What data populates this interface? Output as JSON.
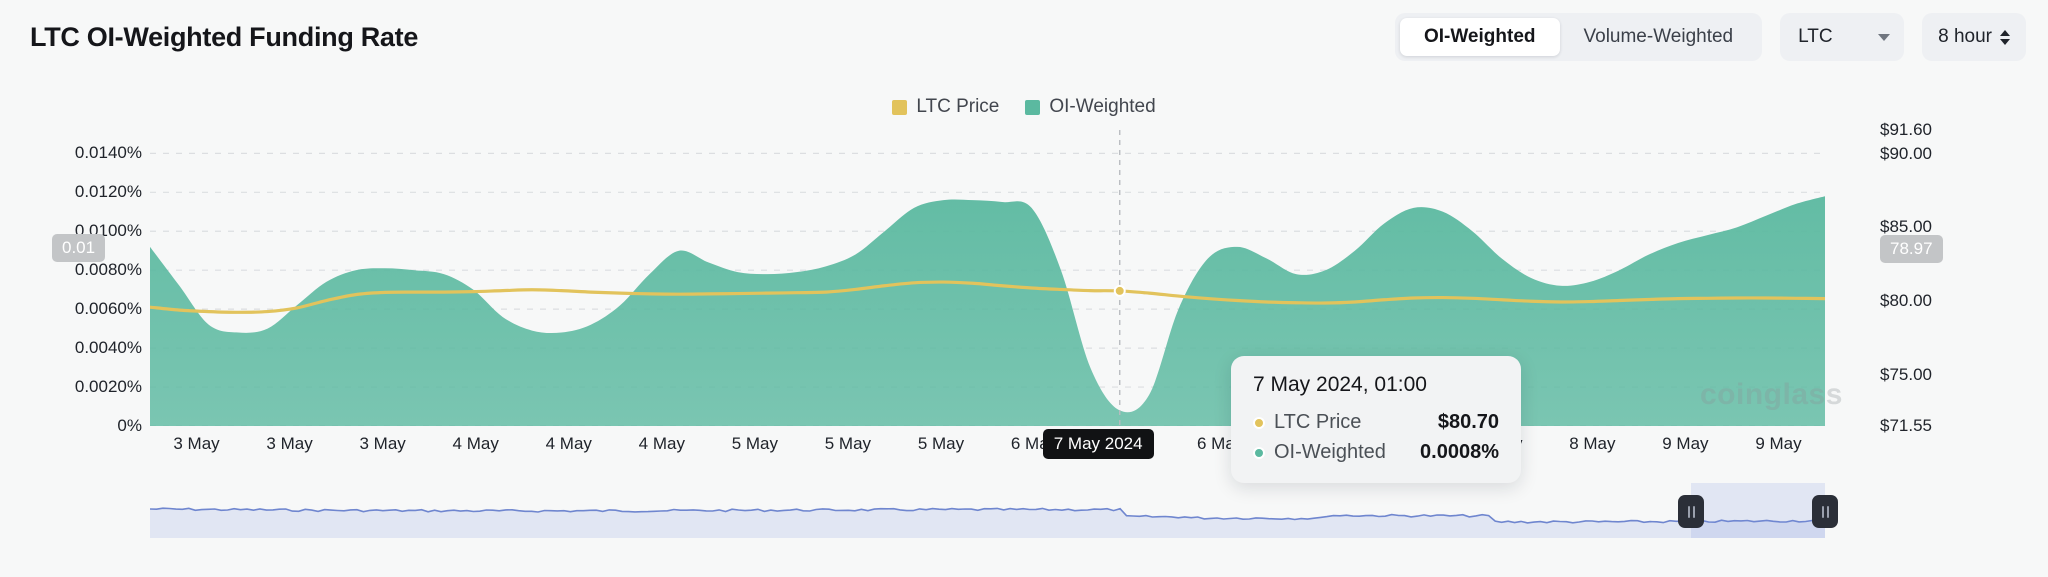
{
  "header": {
    "title": "LTC OI-Weighted Funding Rate",
    "toggle": [
      {
        "label": "OI-Weighted",
        "active": true
      },
      {
        "label": "Volume-Weighted",
        "active": false
      }
    ],
    "asset_select": {
      "value": "LTC",
      "icon": "chevron-down-icon"
    },
    "interval_stepper": {
      "value": "8 hour",
      "icon": "stepper-arrows-icon"
    }
  },
  "legend": [
    {
      "label": "LTC Price",
      "color": "#e2c35c"
    },
    {
      "label": "OI-Weighted",
      "color": "#5bb9a0"
    }
  ],
  "tooltip": {
    "date": "7 May 2024, 01:00",
    "rows": [
      {
        "name": "LTC Price",
        "value": "$80.70",
        "color": "#e2c35c"
      },
      {
        "name": "OI-Weighted",
        "value": "0.0008%",
        "color": "#5bb9a0"
      }
    ]
  },
  "crosshair": {
    "x_badge": "7 May 2024",
    "y_left_badge": "0.01",
    "y_right_badge": "78.97"
  },
  "watermark": "coinglass",
  "navigator": {
    "selection_start_pct": 92.0,
    "selection_end_pct": 100.0,
    "handle_icon": "drag-handle-icon"
  },
  "chart_data": {
    "type": "area",
    "title": "LTC OI-Weighted Funding Rate",
    "xlabel": "",
    "ylabel": "",
    "grid": true,
    "legend_position": "top-center",
    "x_ticks": [
      "3 May",
      "3 May",
      "3 May",
      "4 May",
      "4 May",
      "4 May",
      "5 May",
      "5 May",
      "5 May",
      "6 May",
      "6 May",
      "6 May",
      "7 May",
      "7 May",
      "8 May",
      "8 May",
      "9 May",
      "9 May"
    ],
    "left_axis": {
      "name": "OI-Weighted",
      "ticks": [
        "0.0140%",
        "0.0120%",
        "0.0100%",
        "0.0080%",
        "0.0060%",
        "0.0040%",
        "0.0020%",
        "0%"
      ],
      "tick_values": [
        0.014,
        0.012,
        0.01,
        0.008,
        0.006,
        0.004,
        0.002,
        0
      ],
      "ylim": [
        0,
        0.0152
      ]
    },
    "right_axis": {
      "name": "LTC Price",
      "ticks": [
        "$91.60",
        "$90.00",
        "$85.00",
        "$80.00",
        "$75.00",
        "$71.55"
      ],
      "tick_values": [
        91.6,
        90.0,
        85.0,
        80.0,
        75.0,
        71.55
      ],
      "ylim": [
        71.55,
        91.6
      ]
    },
    "series": [
      {
        "name": "OI-Weighted",
        "type": "area",
        "color": "#5bb9a0",
        "unit": "%",
        "values": [
          0.0092,
          0.0072,
          0.0052,
          0.0048,
          0.005,
          0.0062,
          0.0074,
          0.008,
          0.0081,
          0.008,
          0.0078,
          0.007,
          0.0056,
          0.0049,
          0.0048,
          0.0052,
          0.0062,
          0.0078,
          0.009,
          0.0084,
          0.0079,
          0.0078,
          0.0079,
          0.0082,
          0.0088,
          0.01,
          0.0112,
          0.0116,
          0.0116,
          0.0115,
          0.0112,
          0.008,
          0.003,
          0.0008,
          0.0016,
          0.006,
          0.0086,
          0.0092,
          0.0086,
          0.0078,
          0.008,
          0.009,
          0.0104,
          0.0112,
          0.011,
          0.01,
          0.0086,
          0.0076,
          0.0072,
          0.0074,
          0.008,
          0.0088,
          0.0094,
          0.0098,
          0.0102,
          0.0108,
          0.0114,
          0.0118
        ]
      },
      {
        "name": "LTC Price",
        "type": "line",
        "color": "#e2c35c",
        "unit": "$",
        "values": [
          79.6,
          79.4,
          79.3,
          79.25,
          79.3,
          79.55,
          80.05,
          80.45,
          80.6,
          80.62,
          80.62,
          80.65,
          80.72,
          80.78,
          80.72,
          80.62,
          80.55,
          80.5,
          80.48,
          80.5,
          80.52,
          80.55,
          80.58,
          80.62,
          80.8,
          81.05,
          81.25,
          81.3,
          81.22,
          81.05,
          80.9,
          80.8,
          80.72,
          80.7,
          80.55,
          80.35,
          80.18,
          80.05,
          79.95,
          79.9,
          79.88,
          79.95,
          80.1,
          80.22,
          80.25,
          80.2,
          80.1,
          80.0,
          79.95,
          79.98,
          80.05,
          80.12,
          80.18,
          80.2,
          80.22,
          80.22,
          80.2,
          80.18
        ]
      }
    ],
    "highlight_point": {
      "x": "7 May 2024, 01:00",
      "oi_weighted": "0.0008%",
      "ltc_price": "$80.70"
    }
  }
}
